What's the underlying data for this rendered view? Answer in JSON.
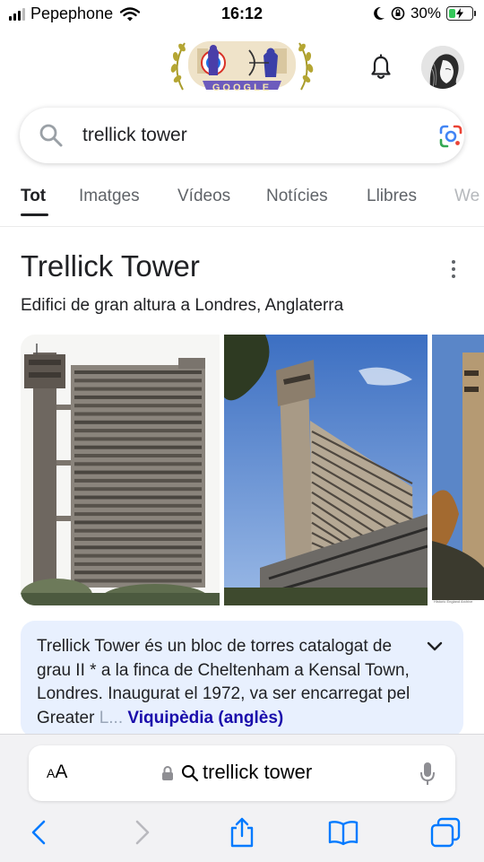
{
  "status_bar": {
    "carrier": "Pepephone",
    "time": "16:12",
    "battery_percent": "30%",
    "battery_level": 0.3,
    "icons": [
      "signal-bars-icon",
      "wifi-icon",
      "do-not-disturb-moon-icon",
      "orientation-lock-icon",
      "battery-charging-icon"
    ]
  },
  "header": {
    "doodle_text": "GOOGLE",
    "icons": [
      "google-doodle-logo",
      "notifications-bell-icon",
      "account-avatar"
    ]
  },
  "search": {
    "query": "trellick tower",
    "icons": [
      "search-icon",
      "google-lens-icon"
    ]
  },
  "tabs": [
    "Tot",
    "Imatges",
    "Vídeos",
    "Notícies",
    "Llibres",
    "We"
  ],
  "active_tab": "Tot",
  "knowledge_panel": {
    "title": "Trellick Tower",
    "subtitle": "Edifici de gran altura a Londres, Anglaterra",
    "description": "Trellick Tower és un bloc de torres catalogat de grau II * a la finca de Cheltenham a Kensal Town, Londres. Inaugurat el 1972, va ser encarregat pel Greater ",
    "description_faded": "L...",
    "source_link": "Viquipèdia (anglès)",
    "photo_caption": "Historic England Archive"
  },
  "safari": {
    "text_size_label": "AA",
    "url": "trellick tower",
    "toolbar": [
      "back-icon",
      "forward-icon",
      "share-icon",
      "bookmarks-icon",
      "tabs-icon"
    ]
  },
  "colors": {
    "link": "#1a0dab",
    "card_bg": "#e8f0fe",
    "ios_blue": "#007aff"
  }
}
